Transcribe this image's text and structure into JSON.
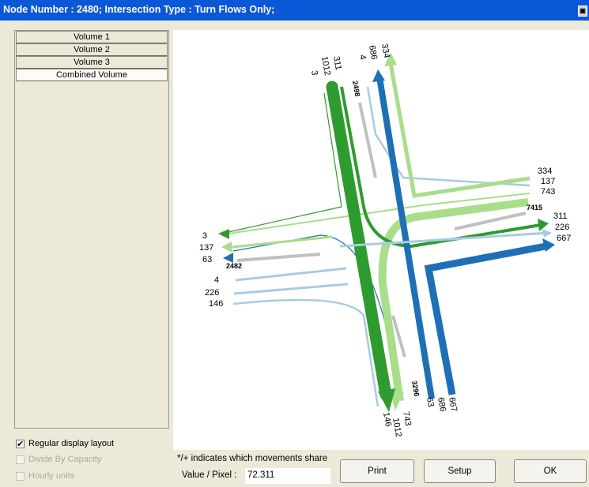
{
  "window": {
    "title": "Node Number : 2480; Intersection Type : Turn Flows Only;"
  },
  "tabs": [
    "Volume 1",
    "Volume 2",
    "Volume 3",
    "Combined Volume"
  ],
  "options": {
    "regular_layout": {
      "label": "Regular display layout",
      "checked": true
    },
    "divide_by_capacity": {
      "label": "Divide By Capacity",
      "checked": false,
      "enabled": false
    },
    "hourly_units": {
      "label": "Hourly units",
      "checked": false,
      "enabled": false
    }
  },
  "footer": {
    "note": "*/+ indicates which movements share",
    "value_per_pixel_label": "Value / Pixel :",
    "value_per_pixel": "72.311"
  },
  "buttons": {
    "print": "Print",
    "setup": "Setup",
    "ok": "OK"
  },
  "diagram": {
    "node_labels": {
      "north": "2498",
      "east": "7415",
      "west": "2482",
      "south": "3296"
    },
    "north_in": [
      "1012",
      "311",
      "3"
    ],
    "north_out": [
      "686",
      "4",
      "334"
    ],
    "east_in": [
      "334",
      "137",
      "743"
    ],
    "east_out": [
      "311",
      "226",
      "667"
    ],
    "west_out": [
      "3",
      "137",
      "63"
    ],
    "west_in": [
      "4",
      "226",
      "146"
    ],
    "south_out": [
      "146",
      "743",
      "1012"
    ],
    "south_in": [
      "63",
      "686",
      "667"
    ]
  },
  "colors": {
    "dark_green": "#2e9b2e",
    "light_green": "#a8dd8a",
    "blue": "#1f6fb5",
    "light_blue": "#a9cbe2",
    "gray": "#c0c0c0",
    "title_bar": "#0a58d8"
  }
}
